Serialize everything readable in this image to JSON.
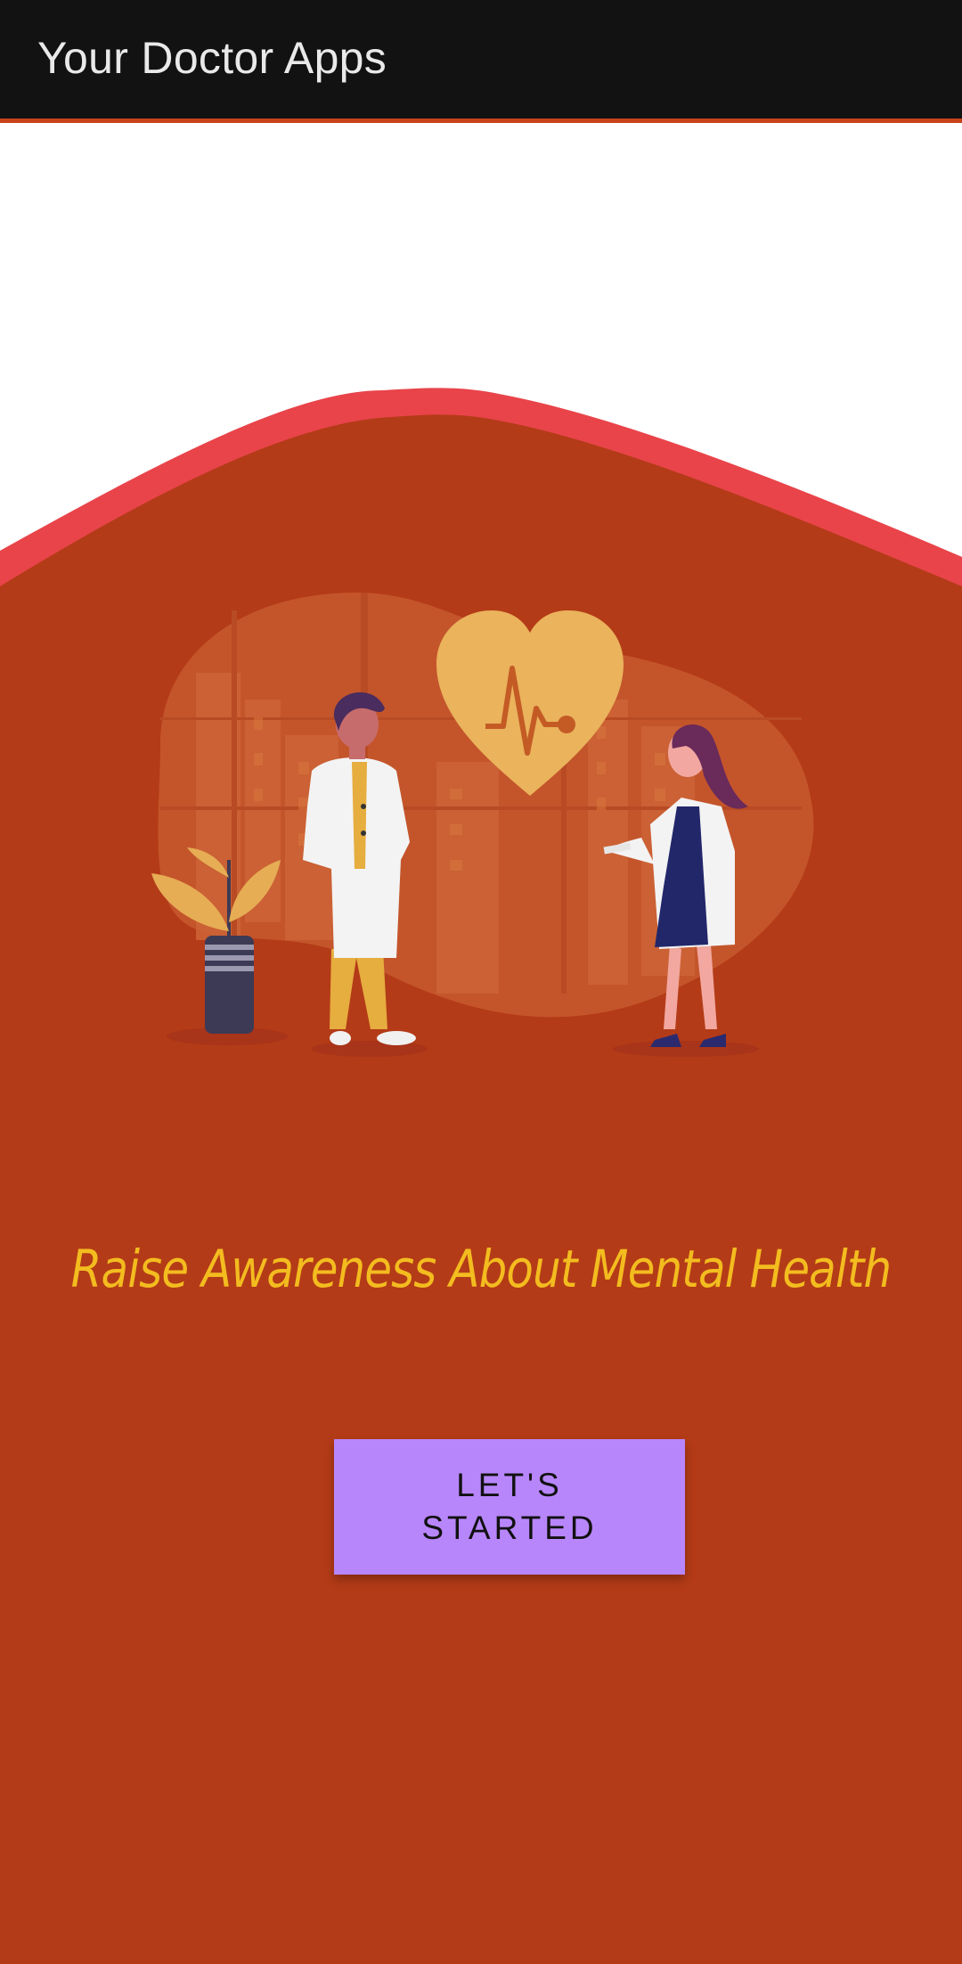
{
  "app_bar": {
    "title": "Your Doctor Apps"
  },
  "hero": {
    "illustration": "two-doctors-with-heart-illustration",
    "tagline": "Raise Awareness About Mental Health"
  },
  "actions": {
    "start_label": "LET'S STARTED"
  },
  "colors": {
    "app_bar": "#121212",
    "background": "#b43b17",
    "wave_edge": "#e8444a",
    "tagline": "#f3bc1f",
    "button": "#b886fb",
    "heart": "#eab35c"
  }
}
